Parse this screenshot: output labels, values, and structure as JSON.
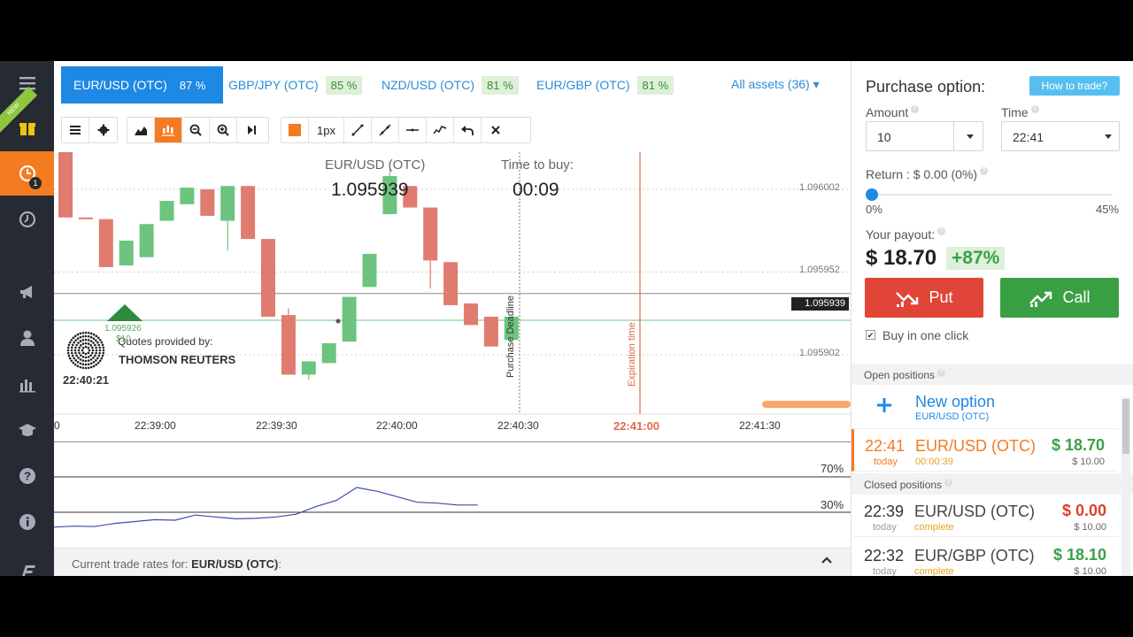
{
  "sidebar": {
    "new_ribbon": "NEW",
    "badge": "1"
  },
  "tabs": [
    {
      "label": "EUR/USD (OTC)",
      "pct": "87 %"
    },
    {
      "label": "GBP/JPY (OTC)",
      "pct": "85 %"
    },
    {
      "label": "NZD/USD (OTC)",
      "pct": "81 %"
    },
    {
      "label": "EUR/GBP (OTC)",
      "pct": "81 %"
    }
  ],
  "all_assets": "All assets (36) ▾",
  "toolbar": {
    "px_label": "1px"
  },
  "chart": {
    "asset_title": "EUR/USD (OTC)",
    "price": "1.095939",
    "time_to_buy_label": "Time to buy:",
    "time_to_buy": "00:09",
    "purchase_deadline": "Purchase Deadline",
    "expiration_time": "Expiration time",
    "quotes_by": "Quotes provided by:",
    "provider": "THOMSON REUTERS",
    "clock": "22:40:21",
    "marker_price": "1.095926",
    "marker_amount": "$10",
    "current_price_tag": "1.095939",
    "y_labels": [
      "1.096002",
      "1.095952",
      "1.095902"
    ],
    "x_labels": [
      "22:39:00",
      "22:39:30",
      "22:40:00",
      "22:40:30",
      "22:41:00",
      "22:41:30"
    ],
    "x_label_edge": "0",
    "osc_labels": [
      "70%",
      "30%"
    ]
  },
  "chart_data": {
    "type": "candlestick",
    "x_ticks": [
      "22:39:00",
      "22:39:30",
      "22:40:00",
      "22:40:30",
      "22:41:00",
      "22:41:30"
    ],
    "y_ticks": [
      1.096002,
      1.095952,
      1.095902
    ],
    "current_price": 1.095939,
    "candles": [
      {
        "o": 1.096025,
        "c": 1.095985,
        "h": 1.096025,
        "l": 1.095985
      },
      {
        "o": 1.095985,
        "c": 1.095984,
        "h": 1.095985,
        "l": 1.095984
      },
      {
        "o": 1.095984,
        "c": 1.095955,
        "h": 1.095984,
        "l": 1.095955
      },
      {
        "o": 1.095956,
        "c": 1.095971,
        "h": 1.095971,
        "l": 1.095956
      },
      {
        "o": 1.095961,
        "c": 1.095981,
        "h": 1.095981,
        "l": 1.095961
      },
      {
        "o": 1.095983,
        "c": 1.095995,
        "h": 1.095995,
        "l": 1.095983
      },
      {
        "o": 1.095993,
        "c": 1.096003,
        "h": 1.096003,
        "l": 1.095993
      },
      {
        "o": 1.096002,
        "c": 1.095986,
        "h": 1.096002,
        "l": 1.095986
      },
      {
        "o": 1.095983,
        "c": 1.096004,
        "h": 1.096004,
        "l": 1.095965
      },
      {
        "o": 1.096004,
        "c": 1.095972,
        "h": 1.096004,
        "l": 1.095972
      },
      {
        "o": 1.095972,
        "c": 1.095925,
        "h": 1.095972,
        "l": 1.095925
      },
      {
        "o": 1.095926,
        "c": 1.09589,
        "h": 1.09593,
        "l": 1.09589
      },
      {
        "o": 1.09589,
        "c": 1.095898,
        "h": 1.095898,
        "l": 1.095887
      },
      {
        "o": 1.095897,
        "c": 1.095909,
        "h": 1.095909,
        "l": 1.095897
      },
      {
        "o": 1.09591,
        "c": 1.095937,
        "h": 1.095937,
        "l": 1.09591
      },
      {
        "o": 1.095943,
        "c": 1.095963,
        "h": 1.095963,
        "l": 1.095943
      },
      {
        "o": 1.095987,
        "c": 1.09601,
        "h": 1.096015,
        "l": 1.095987
      },
      {
        "o": 1.096004,
        "c": 1.095991,
        "h": 1.096004,
        "l": 1.095991
      },
      {
        "o": 1.095991,
        "c": 1.095959,
        "h": 1.095991,
        "l": 1.095942
      },
      {
        "o": 1.095958,
        "c": 1.095932,
        "h": 1.095958,
        "l": 1.095932
      },
      {
        "o": 1.095933,
        "c": 1.09592,
        "h": 1.095933,
        "l": 1.09592
      },
      {
        "o": 1.095925,
        "c": 1.095907,
        "h": 1.095925,
        "l": 1.095907
      },
      {
        "o": 1.095911,
        "c": 1.095925,
        "h": 1.095925,
        "l": 1.095911
      }
    ],
    "oscillator": [
      12,
      14,
      13,
      20,
      24,
      28,
      27,
      38,
      34,
      30,
      31,
      34,
      40,
      57,
      70,
      98,
      90,
      78,
      66,
      64,
      60,
      60
    ],
    "oscillator_levels": [
      70,
      30
    ]
  },
  "panel": {
    "title": "Purchase option:",
    "how_to": "How to trade?",
    "amount_label": "Amount",
    "amount_value": "10",
    "time_label": "Time",
    "time_value": "22:41",
    "return_label": "Return : $ 0.00 (0%)",
    "return_pct": 0,
    "slider_min": "0%",
    "slider_max": "45%",
    "payout_label": "Your payout:",
    "payout_value": "$ 18.70",
    "payout_pct": "+87%",
    "put_label": "Put",
    "call_label": "Call",
    "buy_one_click": "Buy in one click",
    "open_positions": "Open positions",
    "new_option": "New option",
    "new_option_asset": "EUR/USD (OTC)",
    "open_rows": [
      {
        "time": "22:41",
        "sub": "today",
        "asset": "EUR/USD (OTC)",
        "status": "00:00:39",
        "amount": "$ 18.70",
        "invest": "$ 10.00"
      }
    ],
    "closed_positions": "Closed positions",
    "closed_rows": [
      {
        "time": "22:39",
        "sub": "today",
        "asset": "EUR/USD (OTC)",
        "status": "complete",
        "amount": "$ 0.00",
        "invest": "$ 10.00"
      },
      {
        "time": "22:32",
        "sub": "today",
        "asset": "EUR/GBP (OTC)",
        "status": "complete",
        "amount": "$ 18.10",
        "invest": "$ 10.00"
      }
    ]
  },
  "rates_bar": {
    "label": "Current trade rates for:",
    "asset": "EUR/USD (OTC)",
    "colon": ":"
  },
  "colors": {
    "accent": "#1e88e5",
    "orange": "#f47b20",
    "up": "#6cc47e",
    "down": "#e07b6f",
    "put": "#e04537",
    "call": "#3aa044"
  }
}
